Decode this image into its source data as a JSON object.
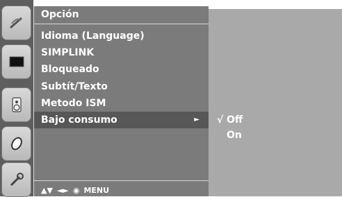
{
  "menu": {
    "title": "Opción",
    "items": [
      {
        "label": "Idioma (Language)"
      },
      {
        "label": "SIMPLINK"
      },
      {
        "label": "Bloqueado"
      },
      {
        "label": "Subtít/Texto"
      },
      {
        "label": "Metodo ISM"
      },
      {
        "label": "Bajo consumo",
        "arrow": "►"
      }
    ],
    "selected_item": "Bajo consumo"
  },
  "submenu": {
    "check_mark": "√",
    "options": [
      {
        "label": "Off",
        "checked": true
      },
      {
        "label": "On",
        "checked": false
      }
    ]
  },
  "nav_hint": {
    "updown": "▲▼",
    "leftright": "◄►",
    "ok": "◉",
    "menu": "MENU"
  },
  "sidebar": {
    "icons": [
      "satellite-dish-icon",
      "picture-icon",
      "speaker-icon",
      "clock-icon",
      "option-wrench-icon"
    ]
  },
  "colors": {
    "menu_bg": "#7b7b7b",
    "submenu_bg": "#a9a9a9",
    "selected_bg": "#575757",
    "sidebar_bg": "#5e5e5e"
  }
}
